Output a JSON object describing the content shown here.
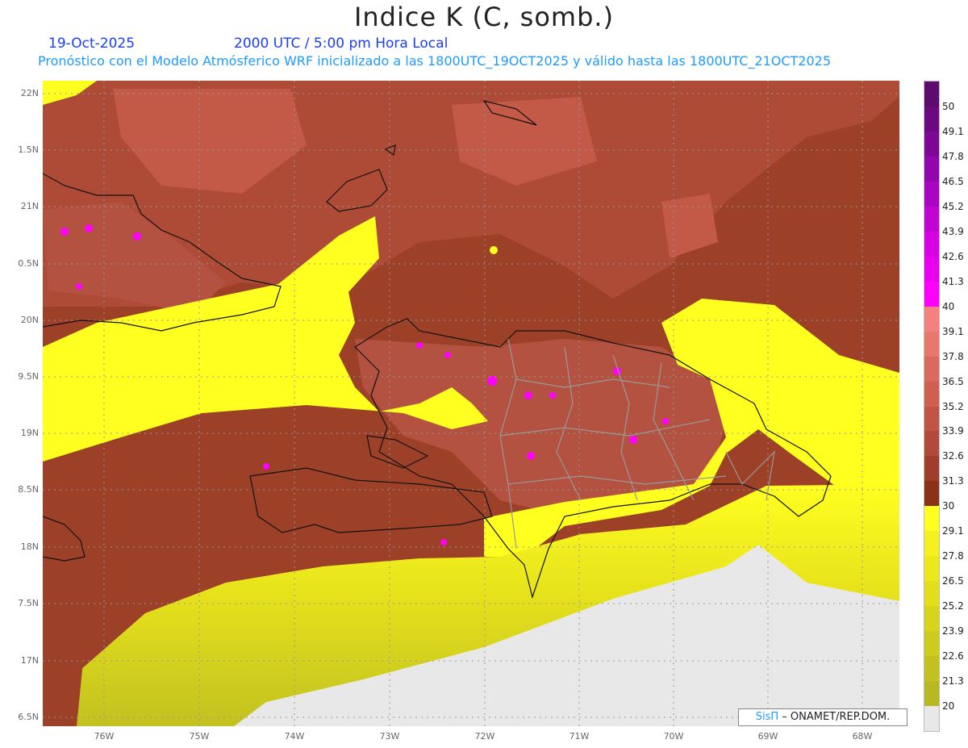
{
  "header": {
    "title": "Indice K (C, somb.)",
    "date": "19-Oct-2025",
    "time": "2000 UTC / 5:00 pm Hora Local",
    "subtitle": "Pronóstico con el Modelo Atmósferico WRF inicializado a las 1800UTC_19OCT2025 y válido hasta las  1800UTC_21OCT2025"
  },
  "map": {
    "lat_labels": [
      "22N",
      "1.5N",
      "21N",
      "0.5N",
      "20N",
      "9.5N",
      "19N",
      "8.5N",
      "18N",
      "7.5N",
      "17N",
      "6.5N"
    ],
    "lon_labels": [
      "76W",
      "75W",
      "74W",
      "73W",
      "72W",
      "71W",
      "70W",
      "69W",
      "68W"
    ],
    "colors": {
      "brown": "#9c4028",
      "yellow": "#ffff20",
      "gray": "#e8e8e8"
    }
  },
  "colorbar": {
    "labels": [
      "50",
      "49.1",
      "47.8",
      "46.5",
      "45.2",
      "43.9",
      "42.6",
      "41.3",
      "40",
      "39.1",
      "37.8",
      "36.5",
      "35.2",
      "33.9",
      "32.6",
      "31.3",
      "30",
      "29.1",
      "27.8",
      "26.5",
      "25.2",
      "23.9",
      "22.6",
      "21.3",
      "20"
    ],
    "colors": [
      "#5e0b70",
      "#6c0880",
      "#7e0896",
      "#9206ad",
      "#a806c0",
      "#c004d4",
      "#d800e4",
      "#ea00f0",
      "#ff00ff",
      "#f48080",
      "#e8776c",
      "#db6a5e",
      "#cf6050",
      "#c05545",
      "#b04a3a",
      "#a03e2c",
      "#8b3118",
      "#ffff20",
      "#f5f020",
      "#ece81e",
      "#e2de1c",
      "#d8d41c",
      "#cdcb1e",
      "#c2c120",
      "#b8b822",
      "#e8e8e8"
    ]
  },
  "credit": {
    "brand": "SisΠ",
    "text": " – ONAMET/REP.DOM."
  }
}
